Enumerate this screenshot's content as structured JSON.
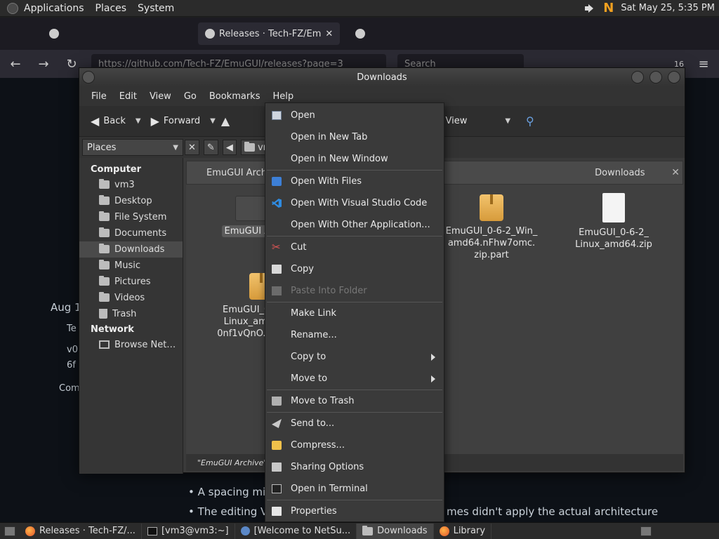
{
  "top_panel": {
    "menus": [
      "Applications",
      "Places",
      "System"
    ],
    "clock": "Sat May 25,  5:35 PM"
  },
  "browser": {
    "tabs": [
      "Releases · Tech-FZ/Em"
    ],
    "url": "https://github.com/Tech-FZ/EmuGUI/releases?page=3",
    "search_placeholder": "Search",
    "notif_count": "16",
    "bg_texts": {
      "date": "Aug 1",
      "author": "Te",
      "tag": "v0",
      "commit": "6f",
      "compare": "Com",
      "bullet1": "A spacing mi",
      "bullet2": "The editing V",
      "bullet2_end": "mes didn't apply the actual architecture"
    }
  },
  "file_manager": {
    "title": "Downloads",
    "menus": [
      "File",
      "Edit",
      "View",
      "Go",
      "Bookmarks",
      "Help"
    ],
    "toolbar": {
      "back": "Back",
      "forward": "Forward",
      "view_mode": "Icon View"
    },
    "places_label": "Places",
    "location_crumb": "vm",
    "sidebar": {
      "computer_label": "Computer",
      "computer_items": [
        "vm3",
        "Desktop",
        "File System",
        "Documents",
        "Downloads",
        "Music",
        "Pictures",
        "Videos",
        "Trash"
      ],
      "network_label": "Network",
      "network_items": [
        "Browse Net…"
      ]
    },
    "pane_tabs": [
      "EmuGUI Archi",
      "Downloads"
    ],
    "left_files": {
      "folder": "EmuGUI Ar",
      "archive_line1": "EmuGUI_0-",
      "archive_line2": "Linux_amd",
      "archive_line3": "0nf1vQnO.zi"
    },
    "right_files": [
      {
        "line1": "EmuGUI_0-6-2_Win_",
        "line2": "amd64.nFhw7omc.",
        "line3": "zip.part"
      },
      {
        "line1": "EmuGUI_0-6-2_",
        "line2": "Linux_amd64.zip"
      }
    ],
    "status": "\"EmuGUI Archive\" s"
  },
  "context_menu": {
    "items": [
      {
        "label": "Open",
        "icon": "open-icon"
      },
      {
        "label": "Open in New Tab"
      },
      {
        "label": "Open in New Window"
      },
      {
        "label": "Open With Files",
        "icon": "files-icon"
      },
      {
        "label": "Open With Visual Studio Code",
        "icon": "vscode-icon"
      },
      {
        "label": "Open With Other Application..."
      },
      {
        "label": "Cut",
        "icon": "scissors-icon"
      },
      {
        "label": "Copy",
        "icon": "copy-icon"
      },
      {
        "label": "Paste Into Folder",
        "icon": "paste-icon",
        "disabled": true
      },
      {
        "label": "Make Link"
      },
      {
        "label": "Rename..."
      },
      {
        "label": "Copy to"
      },
      {
        "label": "Move to"
      },
      {
        "label": "Move to Trash",
        "icon": "trash-icon"
      },
      {
        "label": "Send to...",
        "icon": "send-icon"
      },
      {
        "label": "Compress...",
        "icon": "archive-icon"
      },
      {
        "label": "Sharing Options",
        "icon": "share-icon"
      },
      {
        "label": "Open in Terminal",
        "icon": "terminal-icon"
      },
      {
        "label": "Properties",
        "icon": "properties-icon"
      }
    ]
  },
  "taskbar": {
    "tasks": [
      "Releases · Tech-FZ/...",
      "[vm3@vm3:~]",
      "[Welcome to NetSu...",
      "Downloads",
      "Library"
    ]
  }
}
